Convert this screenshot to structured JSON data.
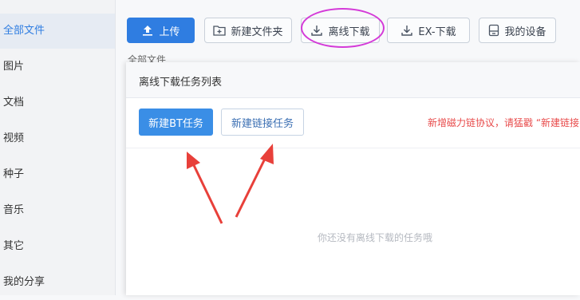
{
  "sidebar": {
    "items": [
      {
        "label": "全部文件",
        "active": true
      },
      {
        "label": "图片"
      },
      {
        "label": "文档"
      },
      {
        "label": "视频"
      },
      {
        "label": "种子"
      },
      {
        "label": "音乐"
      },
      {
        "label": "其它"
      },
      {
        "label": "我的分享"
      }
    ]
  },
  "toolbar": {
    "upload_label": "上传",
    "new_folder_label": "新建文件夹",
    "offline_download_label": "离线下载",
    "ex_download_label": "EX-下载",
    "my_devices_label": "我的设备"
  },
  "breadcrumb": {
    "label": "全部文件"
  },
  "dialog": {
    "title": "离线下载任务列表",
    "new_bt_label": "新建BT任务",
    "new_link_label": "新建链接任务",
    "notice": "新增磁力链协议，请猛戳  “新建链接",
    "empty_text": "你还没有离线下载的任务哦"
  },
  "colors": {
    "accent": "#2f7de1",
    "annotation_circle": "#d43ad8",
    "annotation_arrow": "#e8403a",
    "notice": "#e84b4b"
  }
}
